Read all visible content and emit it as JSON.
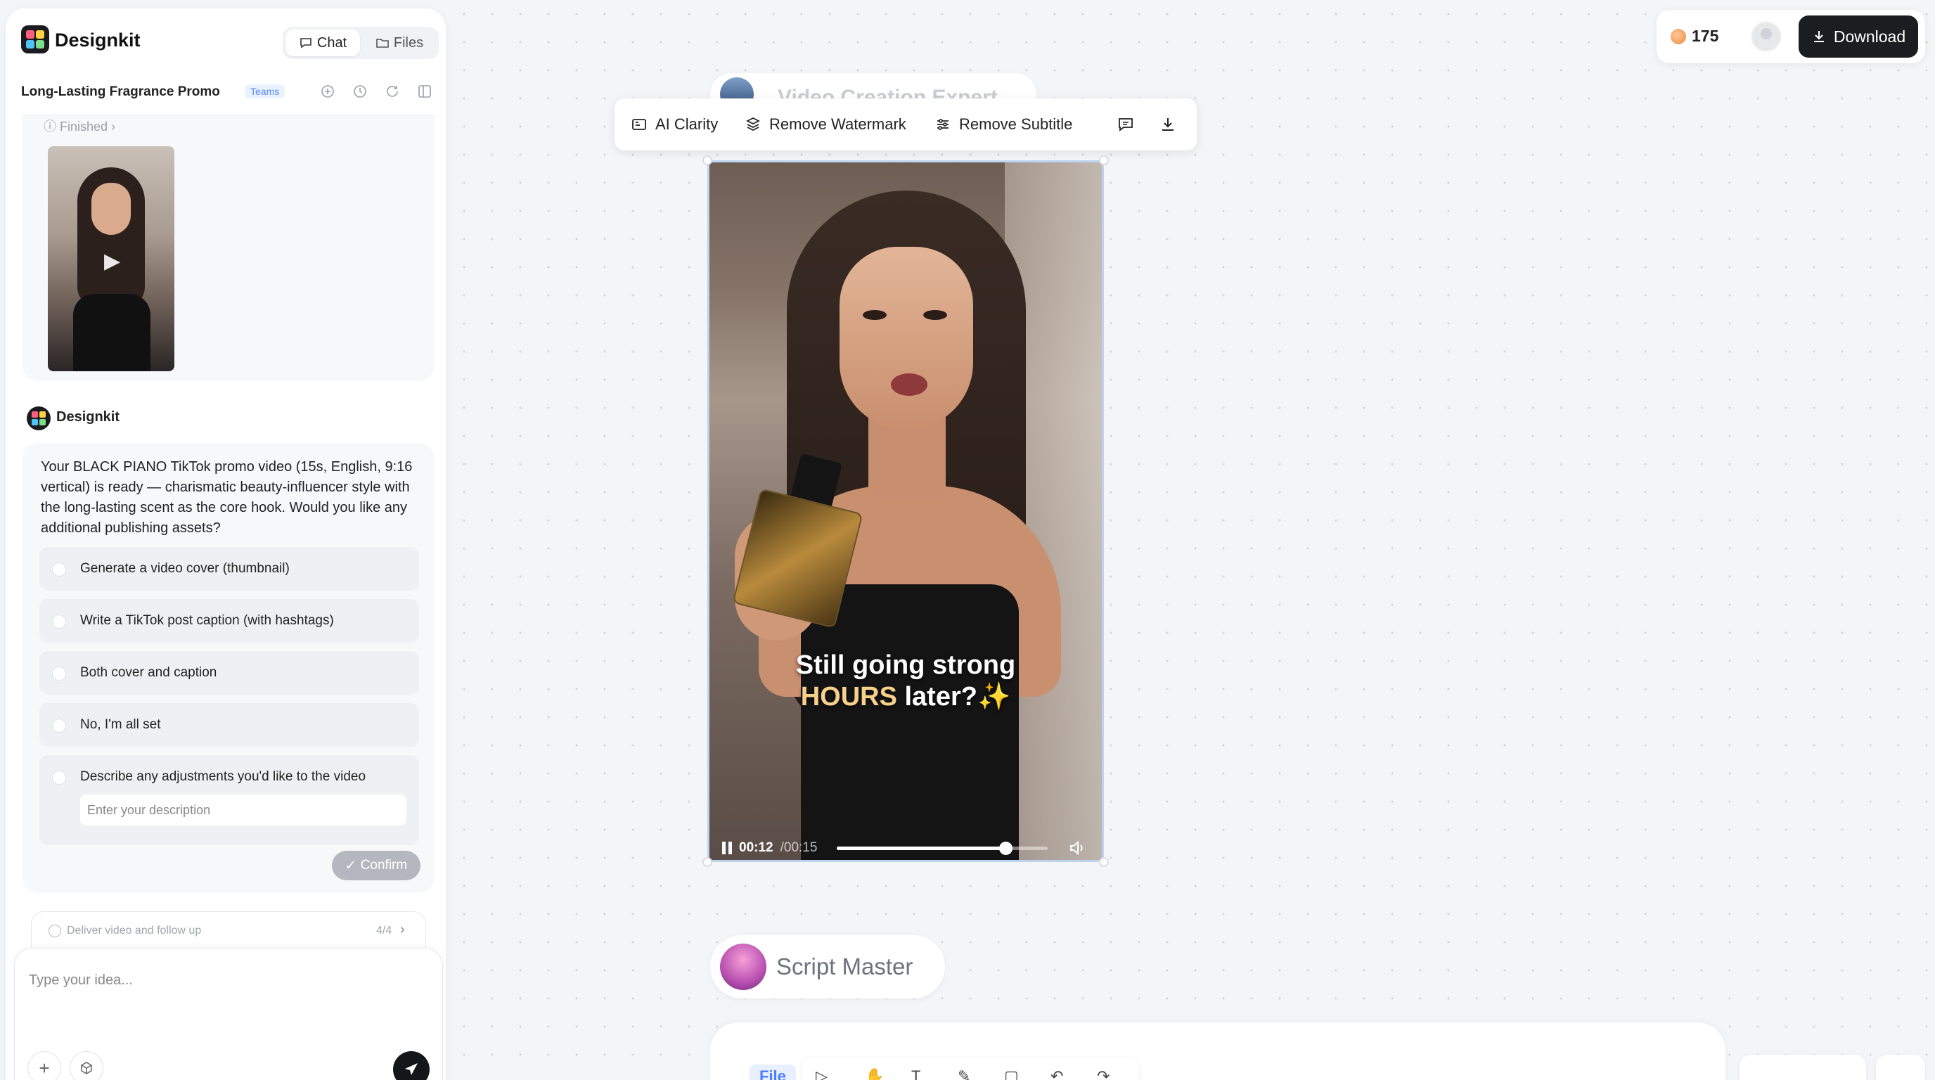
{
  "app": {
    "name": "Designkit"
  },
  "header": {
    "tabs": [
      {
        "label": "Chat",
        "icon": "chat-bubble-icon"
      },
      {
        "label": "Files",
        "icon": "folder-icon"
      }
    ],
    "project_title": "Long-Lasting Fragrance Promo",
    "badge": "Teams",
    "icons": [
      "new-chat-icon",
      "history-icon",
      "refresh-icon",
      "panel-layout-icon"
    ]
  },
  "history": {
    "status": "Finished"
  },
  "assistant": {
    "name": "Designkit",
    "message": "Your BLACK PIANO TikTok promo video (15s, English, 9:16 vertical) is ready — charismatic beauty-influencer style with the long-lasting scent as the core hook. Would you like any additional publishing assets?",
    "options": [
      "Generate a video cover (thumbnail)",
      "Write a TikTok post caption (with hashtags)",
      "Both cover and caption",
      "No, I'm all set",
      "Describe any adjustments you'd like to the video"
    ],
    "description_placeholder": "Enter your description",
    "confirm_label": "Confirm"
  },
  "task_step": {
    "label": "Deliver video and follow up",
    "progress": "4/4"
  },
  "composer": {
    "placeholder": "Type your idea..."
  },
  "topbar": {
    "credits": "175",
    "download_label": "Download"
  },
  "canvas": {
    "ghost_label": "Video Creation Expert",
    "toolbar": [
      {
        "label": "AI Clarity",
        "icon": "ai-clarity-icon"
      },
      {
        "label": "Remove Watermark",
        "icon": "eraser-icon"
      },
      {
        "label": "Remove Subtitle",
        "icon": "sliders-icon"
      }
    ],
    "video": {
      "caption_line1": "Still going strong",
      "caption_highlight": "HOURS",
      "caption_rest": " later?✨",
      "current_time": "00:12",
      "duration": "/00:15",
      "progress": 0.8
    },
    "agent_label": "Script Master",
    "bottom": {
      "file_tab": "File"
    }
  },
  "colors": {
    "accent": "#4c7dff",
    "dark_button": "#1c1d21",
    "selection_border": "#bcd3ee"
  }
}
